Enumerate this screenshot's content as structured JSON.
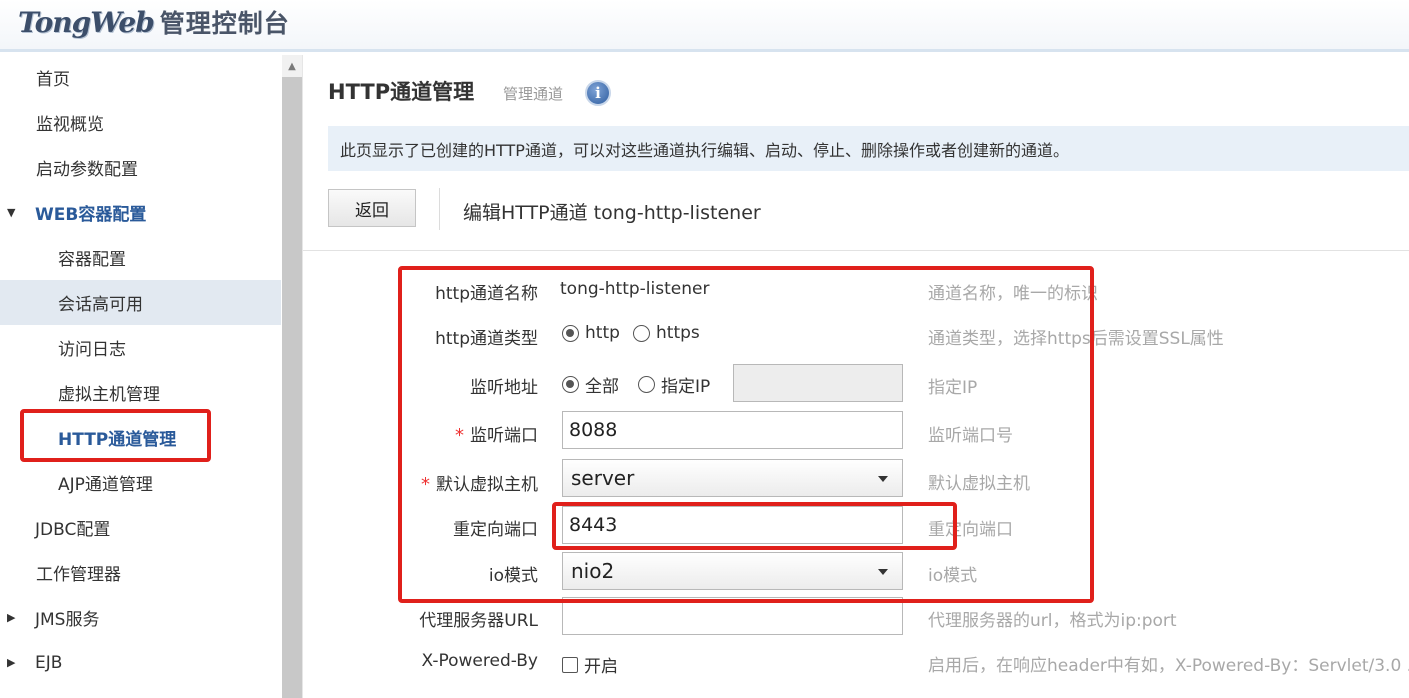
{
  "header": {
    "brand": "TongWeb",
    "suffix": "管理控制台"
  },
  "sidebar": {
    "items": [
      {
        "label": "首页"
      },
      {
        "label": "监视概览"
      },
      {
        "label": "启动参数配置"
      },
      {
        "label": "WEB容器配置",
        "arrow": "▼"
      },
      {
        "label": "容器配置"
      },
      {
        "label": "会话高可用"
      },
      {
        "label": "访问日志"
      },
      {
        "label": "虚拟主机管理"
      },
      {
        "label": "HTTP通道管理"
      },
      {
        "label": "AJP通道管理"
      },
      {
        "label": "JDBC配置"
      },
      {
        "label": "工作管理器"
      },
      {
        "label": "JMS服务",
        "arrow": "▶"
      },
      {
        "label": "EJB",
        "arrow": "▶"
      }
    ]
  },
  "page": {
    "title": "HTTP通道管理",
    "subtitle": "管理通道",
    "info_icon": "i",
    "description": "此页显示了已创建的HTTP通道，可以对这些通道执行编辑、启动、停止、删除操作或者创建新的通道。",
    "back_label": "返回",
    "edit_title": "编辑HTTP通道 tong-http-listener"
  },
  "form": {
    "name": {
      "label": "http通道名称",
      "value": "tong-http-listener",
      "hint": "通道名称，唯一的标识"
    },
    "type": {
      "label": "http通道类型",
      "opt1": "http",
      "opt2": "https",
      "selected": "http",
      "hint": "通道类型，选择https后需设置SSL属性"
    },
    "addr": {
      "label": "监听地址",
      "opt1": "全部",
      "opt2": "指定IP",
      "selected": "全部",
      "ip_value": "",
      "hint": "指定IP"
    },
    "port": {
      "required": "*",
      "label": "监听端口",
      "value": "8088",
      "hint": "监听端口号"
    },
    "vhost": {
      "required": "*",
      "label": "默认虚拟主机",
      "value": "server",
      "hint": "默认虚拟主机"
    },
    "redirect": {
      "label": "重定向端口",
      "value": "8443",
      "hint": "重定向端口"
    },
    "io": {
      "label": "io模式",
      "value": "nio2",
      "hint": "io模式"
    },
    "proxy": {
      "label": "代理服务器URL",
      "value": "",
      "hint": "代理服务器的url，格式为ip:port"
    },
    "powered": {
      "label": "X-Powered-By",
      "checkbox_label": "开启",
      "checked": false,
      "hint": "启用后，在响应header中有如，X-Powered-By：Servlet/3.0 ..."
    }
  },
  "colors": {
    "accent": "#2a5a9a",
    "highlight_box": "#e0201b",
    "desc_bg": "#e8f0f8"
  }
}
